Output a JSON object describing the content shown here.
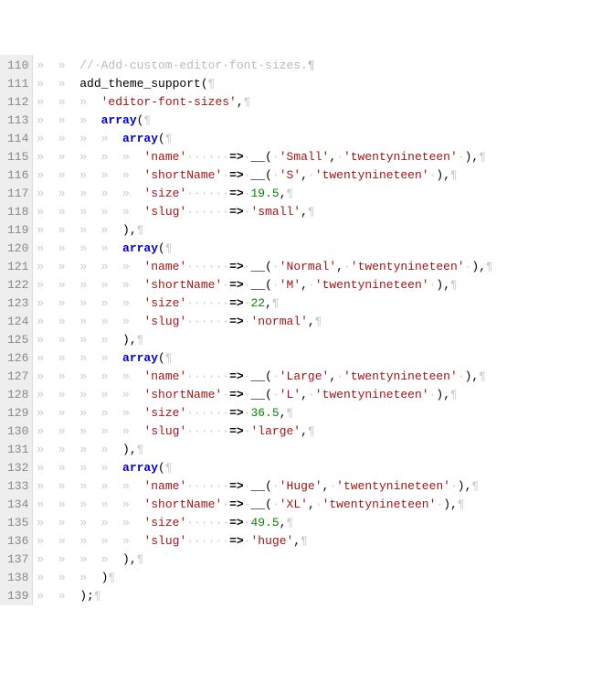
{
  "lines": [
    {
      "num": 110,
      "tokens": [
        [
          "ws",
          "»  »  "
        ],
        [
          "comment",
          "//·Add·custom·editor·font·sizes.¶"
        ]
      ]
    },
    {
      "num": 111,
      "tokens": [
        [
          "ws",
          "»  »  "
        ],
        [
          "func",
          "add_theme_support"
        ],
        [
          "punct",
          "("
        ],
        [
          "ws",
          "¶"
        ]
      ]
    },
    {
      "num": 112,
      "tokens": [
        [
          "ws",
          "»  »  »  "
        ],
        [
          "string",
          "'editor-font-sizes'"
        ],
        [
          "punct",
          ","
        ],
        [
          "ws",
          "¶"
        ]
      ]
    },
    {
      "num": 113,
      "tokens": [
        [
          "ws",
          "»  »  »  "
        ],
        [
          "keyword",
          "array"
        ],
        [
          "punct",
          "("
        ],
        [
          "ws",
          "¶"
        ]
      ]
    },
    {
      "num": 114,
      "tokens": [
        [
          "ws",
          "»  »  »  »  "
        ],
        [
          "keyword",
          "array"
        ],
        [
          "punct",
          "("
        ],
        [
          "ws",
          "¶"
        ]
      ]
    },
    {
      "num": 115,
      "tokens": [
        [
          "ws",
          "»  »  »  »  »  "
        ],
        [
          "string",
          "'name'"
        ],
        [
          "ws",
          "······"
        ],
        [
          "op",
          "=>"
        ],
        [
          "ws",
          "·"
        ],
        [
          "func",
          "__"
        ],
        [
          "punct",
          "("
        ],
        [
          "ws",
          "·"
        ],
        [
          "string",
          "'Small'"
        ],
        [
          "punct",
          ","
        ],
        [
          "ws",
          "·"
        ],
        [
          "string",
          "'twentynineteen'"
        ],
        [
          "ws",
          "·"
        ],
        [
          "punct",
          "),"
        ],
        [
          "ws",
          "¶"
        ]
      ]
    },
    {
      "num": 116,
      "tokens": [
        [
          "ws",
          "»  »  »  »  »  "
        ],
        [
          "string",
          "'shortName'"
        ],
        [
          "ws",
          "·"
        ],
        [
          "op",
          "=>"
        ],
        [
          "ws",
          "·"
        ],
        [
          "func",
          "__"
        ],
        [
          "punct",
          "("
        ],
        [
          "ws",
          "·"
        ],
        [
          "string",
          "'S'"
        ],
        [
          "punct",
          ","
        ],
        [
          "ws",
          "·"
        ],
        [
          "string",
          "'twentynineteen'"
        ],
        [
          "ws",
          "·"
        ],
        [
          "punct",
          "),"
        ],
        [
          "ws",
          "¶"
        ]
      ]
    },
    {
      "num": 117,
      "tokens": [
        [
          "ws",
          "»  »  »  »  »  "
        ],
        [
          "string",
          "'size'"
        ],
        [
          "ws",
          "······"
        ],
        [
          "op",
          "=>"
        ],
        [
          "ws",
          "·"
        ],
        [
          "num",
          "19.5"
        ],
        [
          "punct",
          ","
        ],
        [
          "ws",
          "¶"
        ]
      ]
    },
    {
      "num": 118,
      "tokens": [
        [
          "ws",
          "»  »  »  »  »  "
        ],
        [
          "string",
          "'slug'"
        ],
        [
          "ws",
          "······"
        ],
        [
          "op",
          "=>"
        ],
        [
          "ws",
          "·"
        ],
        [
          "string",
          "'small'"
        ],
        [
          "punct",
          ","
        ],
        [
          "ws",
          "¶"
        ]
      ]
    },
    {
      "num": 119,
      "tokens": [
        [
          "ws",
          "»  »  »  »  "
        ],
        [
          "punct",
          "),"
        ],
        [
          "ws",
          "¶"
        ]
      ]
    },
    {
      "num": 120,
      "tokens": [
        [
          "ws",
          "»  »  »  »  "
        ],
        [
          "keyword",
          "array"
        ],
        [
          "punct",
          "("
        ],
        [
          "ws",
          "¶"
        ]
      ]
    },
    {
      "num": 121,
      "tokens": [
        [
          "ws",
          "»  »  »  »  »  "
        ],
        [
          "string",
          "'name'"
        ],
        [
          "ws",
          "······"
        ],
        [
          "op",
          "=>"
        ],
        [
          "ws",
          "·"
        ],
        [
          "func",
          "__"
        ],
        [
          "punct",
          "("
        ],
        [
          "ws",
          "·"
        ],
        [
          "string",
          "'Normal'"
        ],
        [
          "punct",
          ","
        ],
        [
          "ws",
          "·"
        ],
        [
          "string",
          "'twentynineteen'"
        ],
        [
          "ws",
          "·"
        ],
        [
          "punct",
          "),"
        ],
        [
          "ws",
          "¶"
        ]
      ]
    },
    {
      "num": 122,
      "tokens": [
        [
          "ws",
          "»  »  »  »  »  "
        ],
        [
          "string",
          "'shortName'"
        ],
        [
          "ws",
          "·"
        ],
        [
          "op",
          "=>"
        ],
        [
          "ws",
          "·"
        ],
        [
          "func",
          "__"
        ],
        [
          "punct",
          "("
        ],
        [
          "ws",
          "·"
        ],
        [
          "string",
          "'M'"
        ],
        [
          "punct",
          ","
        ],
        [
          "ws",
          "·"
        ],
        [
          "string",
          "'twentynineteen'"
        ],
        [
          "ws",
          "·"
        ],
        [
          "punct",
          "),"
        ],
        [
          "ws",
          "¶"
        ]
      ]
    },
    {
      "num": 123,
      "tokens": [
        [
          "ws",
          "»  »  »  »  »  "
        ],
        [
          "string",
          "'size'"
        ],
        [
          "ws",
          "······"
        ],
        [
          "op",
          "=>"
        ],
        [
          "ws",
          "·"
        ],
        [
          "num",
          "22"
        ],
        [
          "punct",
          ","
        ],
        [
          "ws",
          "¶"
        ]
      ]
    },
    {
      "num": 124,
      "tokens": [
        [
          "ws",
          "»  »  »  »  »  "
        ],
        [
          "string",
          "'slug'"
        ],
        [
          "ws",
          "······"
        ],
        [
          "op",
          "=>"
        ],
        [
          "ws",
          "·"
        ],
        [
          "string",
          "'normal'"
        ],
        [
          "punct",
          ","
        ],
        [
          "ws",
          "¶"
        ]
      ]
    },
    {
      "num": 125,
      "tokens": [
        [
          "ws",
          "»  »  »  »  "
        ],
        [
          "punct",
          "),"
        ],
        [
          "ws",
          "¶"
        ]
      ]
    },
    {
      "num": 126,
      "tokens": [
        [
          "ws",
          "»  »  »  »  "
        ],
        [
          "keyword",
          "array"
        ],
        [
          "punct",
          "("
        ],
        [
          "ws",
          "¶"
        ]
      ]
    },
    {
      "num": 127,
      "tokens": [
        [
          "ws",
          "»  »  »  »  »  "
        ],
        [
          "string",
          "'name'"
        ],
        [
          "ws",
          "······"
        ],
        [
          "op",
          "=>"
        ],
        [
          "ws",
          "·"
        ],
        [
          "func",
          "__"
        ],
        [
          "punct",
          "("
        ],
        [
          "ws",
          "·"
        ],
        [
          "string",
          "'Large'"
        ],
        [
          "punct",
          ","
        ],
        [
          "ws",
          "·"
        ],
        [
          "string",
          "'twentynineteen'"
        ],
        [
          "ws",
          "·"
        ],
        [
          "punct",
          "),"
        ],
        [
          "ws",
          "¶"
        ]
      ]
    },
    {
      "num": 128,
      "tokens": [
        [
          "ws",
          "»  »  »  »  »  "
        ],
        [
          "string",
          "'shortName'"
        ],
        [
          "ws",
          "·"
        ],
        [
          "op",
          "=>"
        ],
        [
          "ws",
          "·"
        ],
        [
          "func",
          "__"
        ],
        [
          "punct",
          "("
        ],
        [
          "ws",
          "·"
        ],
        [
          "string",
          "'L'"
        ],
        [
          "punct",
          ","
        ],
        [
          "ws",
          "·"
        ],
        [
          "string",
          "'twentynineteen'"
        ],
        [
          "ws",
          "·"
        ],
        [
          "punct",
          "),"
        ],
        [
          "ws",
          "¶"
        ]
      ]
    },
    {
      "num": 129,
      "tokens": [
        [
          "ws",
          "»  »  »  »  »  "
        ],
        [
          "string",
          "'size'"
        ],
        [
          "ws",
          "······"
        ],
        [
          "op",
          "=>"
        ],
        [
          "ws",
          "·"
        ],
        [
          "num",
          "36.5"
        ],
        [
          "punct",
          ","
        ],
        [
          "ws",
          "¶"
        ]
      ]
    },
    {
      "num": 130,
      "tokens": [
        [
          "ws",
          "»  »  »  »  »  "
        ],
        [
          "string",
          "'slug'"
        ],
        [
          "ws",
          "······"
        ],
        [
          "op",
          "=>"
        ],
        [
          "ws",
          "·"
        ],
        [
          "string",
          "'large'"
        ],
        [
          "punct",
          ","
        ],
        [
          "ws",
          "¶"
        ]
      ]
    },
    {
      "num": 131,
      "tokens": [
        [
          "ws",
          "»  »  »  »  "
        ],
        [
          "punct",
          "),"
        ],
        [
          "ws",
          "¶"
        ]
      ]
    },
    {
      "num": 132,
      "tokens": [
        [
          "ws",
          "»  »  »  »  "
        ],
        [
          "keyword",
          "array"
        ],
        [
          "punct",
          "("
        ],
        [
          "ws",
          "¶"
        ]
      ]
    },
    {
      "num": 133,
      "tokens": [
        [
          "ws",
          "»  »  »  »  »  "
        ],
        [
          "string",
          "'name'"
        ],
        [
          "ws",
          "······"
        ],
        [
          "op",
          "=>"
        ],
        [
          "ws",
          "·"
        ],
        [
          "func",
          "__"
        ],
        [
          "punct",
          "("
        ],
        [
          "ws",
          "·"
        ],
        [
          "string",
          "'Huge'"
        ],
        [
          "punct",
          ","
        ],
        [
          "ws",
          "·"
        ],
        [
          "string",
          "'twentynineteen'"
        ],
        [
          "ws",
          "·"
        ],
        [
          "punct",
          "),"
        ],
        [
          "ws",
          "¶"
        ]
      ]
    },
    {
      "num": 134,
      "tokens": [
        [
          "ws",
          "»  »  »  »  »  "
        ],
        [
          "string",
          "'shortName'"
        ],
        [
          "ws",
          "·"
        ],
        [
          "op",
          "=>"
        ],
        [
          "ws",
          "·"
        ],
        [
          "func",
          "__"
        ],
        [
          "punct",
          "("
        ],
        [
          "ws",
          "·"
        ],
        [
          "string",
          "'XL'"
        ],
        [
          "punct",
          ","
        ],
        [
          "ws",
          "·"
        ],
        [
          "string",
          "'twentynineteen'"
        ],
        [
          "ws",
          "·"
        ],
        [
          "punct",
          "),"
        ],
        [
          "ws",
          "¶"
        ]
      ]
    },
    {
      "num": 135,
      "tokens": [
        [
          "ws",
          "»  »  »  »  »  "
        ],
        [
          "string",
          "'size'"
        ],
        [
          "ws",
          "······"
        ],
        [
          "op",
          "=>"
        ],
        [
          "ws",
          "·"
        ],
        [
          "num",
          "49.5"
        ],
        [
          "punct",
          ","
        ],
        [
          "ws",
          "¶"
        ]
      ]
    },
    {
      "num": 136,
      "tokens": [
        [
          "ws",
          "»  »  »  »  »  "
        ],
        [
          "string",
          "'slug'"
        ],
        [
          "ws",
          "······"
        ],
        [
          "op",
          "=>"
        ],
        [
          "ws",
          "·"
        ],
        [
          "string",
          "'huge'"
        ],
        [
          "punct",
          ","
        ],
        [
          "ws",
          "¶"
        ]
      ]
    },
    {
      "num": 137,
      "tokens": [
        [
          "ws",
          "»  »  »  »  "
        ],
        [
          "punct",
          "),"
        ],
        [
          "ws",
          "¶"
        ]
      ]
    },
    {
      "num": 138,
      "tokens": [
        [
          "ws",
          "»  »  »  "
        ],
        [
          "punct",
          ")"
        ],
        [
          "ws",
          "¶"
        ]
      ]
    },
    {
      "num": 139,
      "tokens": [
        [
          "ws",
          "»  »  "
        ],
        [
          "punct",
          ");"
        ],
        [
          "ws",
          "¶"
        ]
      ]
    }
  ]
}
